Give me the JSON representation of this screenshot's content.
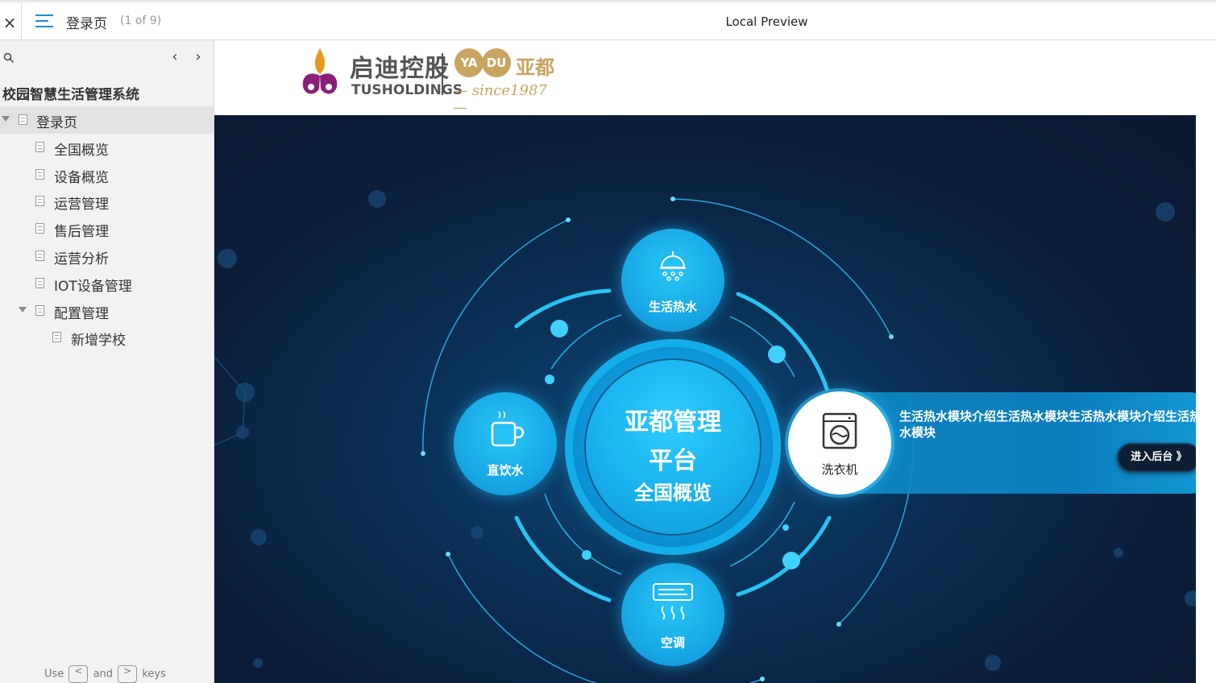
{
  "topbar": {
    "close_glyph": "×",
    "page_title": "登录页",
    "page_count": "(1 of 9)",
    "preview_label": "Local Preview"
  },
  "sidebar": {
    "prev_glyph": "‹",
    "next_glyph": "›",
    "project_title": "校园智慧生活管理系统",
    "items": [
      {
        "label": "登录页"
      },
      {
        "label": "全国概览"
      },
      {
        "label": "设备概览"
      },
      {
        "label": "运营管理"
      },
      {
        "label": "售后管理"
      },
      {
        "label": "运营分析"
      },
      {
        "label": "IOT设备管理"
      },
      {
        "label": "配置管理"
      },
      {
        "label": "新增学校"
      }
    ],
    "footer": {
      "use": "Use",
      "and": "and",
      "keys": "keys",
      "key_prev": "<",
      "key_next": ">"
    }
  },
  "logo": {
    "tus_zh": "启迪控股",
    "tus_en": "TUSHOLDINGS",
    "ya": "YA",
    "du": "DU",
    "yadu_zh": "亚都",
    "since": "— since1987 —"
  },
  "banner": {
    "center_line1": "亚都管理",
    "center_line2": "平台",
    "center_line3": "全国概览",
    "nodes": {
      "top": "生活热水",
      "left": "直饮水",
      "right": "洗衣机",
      "bottom": "空调"
    },
    "info_text": "生活热水模块介绍生活热水模块生活热水模块介绍生活热水模块",
    "enter_button": "进入后台 》"
  },
  "colors": {
    "accent_blue": "#1a8dd6",
    "node_blue": "#18a9e6",
    "banner_dark": "#0b1d38",
    "gold": "#c9a562"
  }
}
